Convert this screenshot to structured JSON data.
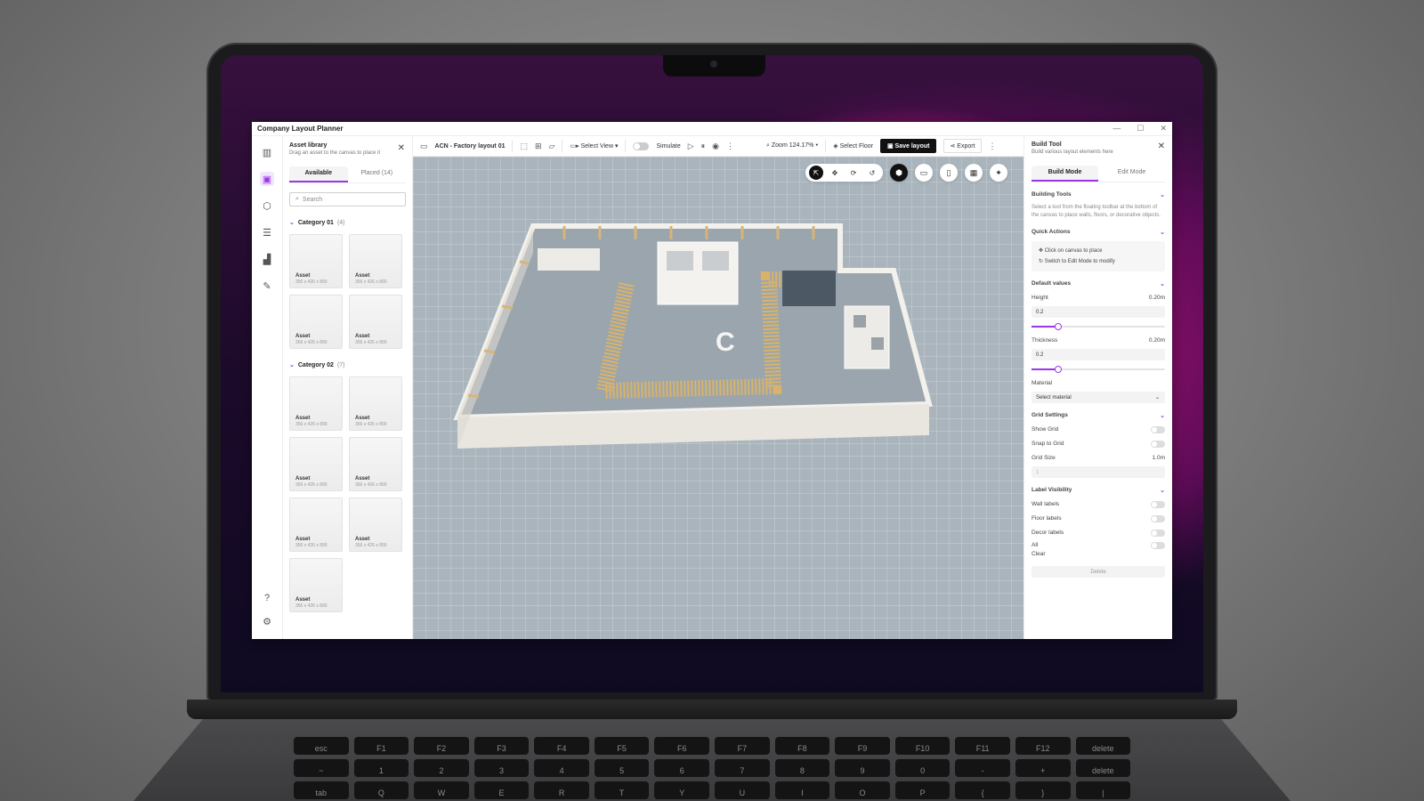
{
  "window": {
    "title": "Company Layout Planner"
  },
  "library": {
    "title": "Asset library",
    "subtitle": "Drag an asset to the canvas to place it",
    "tabs": [
      {
        "label": "Available"
      },
      {
        "label": "Placed (14)"
      }
    ],
    "search_placeholder": "Search",
    "categories": [
      {
        "name": "Category 01",
        "count": "(4)",
        "assets": [
          {
            "label": "Asset",
            "dims": "356 x 426 x 890"
          },
          {
            "label": "Asset",
            "dims": "356 x 426 x 890"
          },
          {
            "label": "Asset",
            "dims": "356 x 426 x 890"
          },
          {
            "label": "Asset",
            "dims": "356 x 426 x 890"
          }
        ]
      },
      {
        "name": "Category 02",
        "count": "(7)",
        "assets": [
          {
            "label": "Asset",
            "dims": "356 x 426 x 890"
          },
          {
            "label": "Asset",
            "dims": "356 x 426 x 890"
          },
          {
            "label": "Asset",
            "dims": "356 x 426 x 890"
          },
          {
            "label": "Asset",
            "dims": "356 x 426 x 890"
          },
          {
            "label": "Asset",
            "dims": "356 x 426 x 890"
          },
          {
            "label": "Asset",
            "dims": "356 x 426 x 890"
          },
          {
            "label": "Asset",
            "dims": "356 x 426 x 890"
          }
        ]
      }
    ]
  },
  "toolbar": {
    "project": "ACN - Factory layout 01",
    "select_view": "Select View",
    "simulate": "Simulate",
    "zoom": "Zoom 124.17%",
    "select_floor": "Select Floor",
    "save": "Save layout",
    "export": "Export"
  },
  "build_tool": {
    "title": "Build Tool",
    "subtitle": "Build various layout elements here",
    "tabs": [
      {
        "label": "Build Mode"
      },
      {
        "label": "Edit Mode"
      }
    ],
    "building_tools": {
      "heading": "Building Tools",
      "text": "Select a tool from the floating toolbar at the bottom of the canvas to place walls, floors, or decorative objects."
    },
    "quick_actions": {
      "heading": "Quick Actions",
      "items": [
        "Click on canvas to place",
        "Switch to Edit Mode to modify"
      ]
    },
    "default_values": {
      "heading": "Default values",
      "height": {
        "label": "Height",
        "value": "0.20m",
        "input": "0.2",
        "fraction": 0.2
      },
      "thickness": {
        "label": "Thickness",
        "value": "0.20m",
        "input": "0.2",
        "fraction": 0.2
      },
      "material": {
        "label": "Material",
        "placeholder": "Select material"
      }
    },
    "grid_settings": {
      "heading": "Grid Settings",
      "show_grid": "Show Grid",
      "snap_to_grid": "Snap to Grid",
      "grid_size_label": "Grid Size",
      "grid_size_value": "1.0m",
      "grid_size_input": "1"
    },
    "label_visibility": {
      "heading": "Label Visibility",
      "wall": "Wall labels",
      "floor": "Floor labels",
      "decor": "Decor labels",
      "all": "All",
      "clear": "Clear"
    },
    "delete": "Delete"
  },
  "colors": {
    "accent": "#9b37e6",
    "hazard": "#d9b36a",
    "floor": "#8f9aa3"
  },
  "keyboard": {
    "row1": [
      "esc",
      "F1",
      "F2",
      "F3",
      "F4",
      "F5",
      "F6",
      "F7",
      "F8",
      "F9",
      "F10",
      "F11",
      "F12",
      "delete"
    ],
    "row2": [
      "~",
      "1",
      "2",
      "3",
      "4",
      "5",
      "6",
      "7",
      "8",
      "9",
      "0",
      "-",
      "+",
      "delete"
    ],
    "row3": [
      "tab",
      "Q",
      "W",
      "E",
      "R",
      "T",
      "Y",
      "U",
      "I",
      "O",
      "P",
      "{",
      "}",
      "|"
    ]
  }
}
